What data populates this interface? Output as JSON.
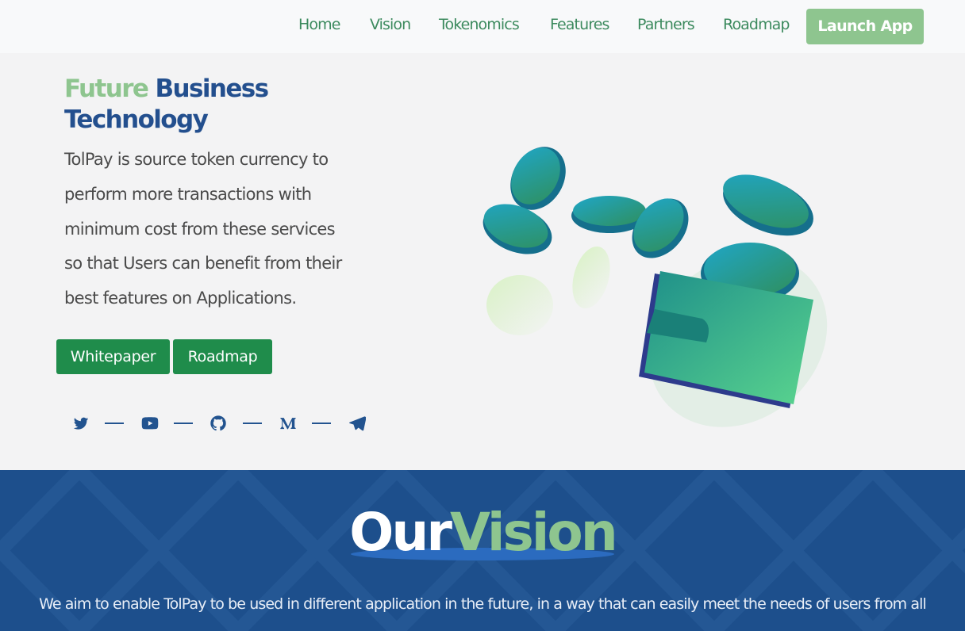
{
  "nav": {
    "items": [
      {
        "label": "Home"
      },
      {
        "label": "Vision"
      },
      {
        "label": "Tokenomics"
      },
      {
        "label": "Features"
      },
      {
        "label": "Partners"
      },
      {
        "label": "Roadmap"
      }
    ],
    "launch_label": "Launch App"
  },
  "hero": {
    "title_accent": "Future",
    "title_rest": "Business",
    "title_line2": "Technology",
    "description_lines": [
      "TolPay is source token currency to",
      "perform more transactions with",
      "minimum cost from these services",
      "so that Users can benefit from their",
      "best features on Applications."
    ],
    "buttons": {
      "whitepaper": "Whitepaper",
      "roadmap": "Roadmap"
    },
    "social_icons": [
      "twitter-icon",
      "youtube-icon",
      "github-icon",
      "medium-icon",
      "telegram-icon"
    ]
  },
  "vision": {
    "title_white": "Our",
    "title_accent": "Vision",
    "text": "We aim to enable TolPay to be used in different application in the future, in a way that can easily meet the needs of users from all"
  },
  "colors": {
    "brand_blue": "#234f8e",
    "brand_green": "#8ec58f",
    "button_green": "#1f8c4b",
    "vision_bg": "#1d4f8c"
  }
}
